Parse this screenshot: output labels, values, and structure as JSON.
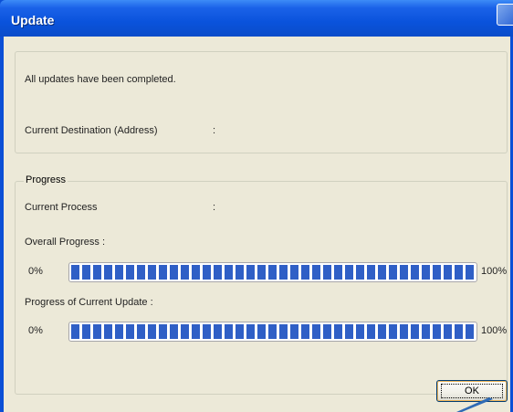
{
  "window": {
    "title": "Update"
  },
  "status": {
    "message": "All updates have been completed.",
    "destination_label": "Current Destination (Address)",
    "destination_sep": ":",
    "destination_value": ""
  },
  "progress": {
    "legend": "Progress",
    "current_process_label": "Current Process",
    "current_process_sep": ":",
    "current_process_value": "",
    "overall": {
      "label": "Overall Progress :",
      "min_label": "0%",
      "max_label": "100%",
      "value": 100
    },
    "current_update": {
      "label": "Progress of Current Update :",
      "min_label": "0%",
      "max_label": "100%",
      "value": 100
    }
  },
  "buttons": {
    "ok_label": "OK"
  },
  "colors": {
    "titlebar": "#0a53dc",
    "dialog_bg": "#ece9d8",
    "progress_block": "#2f5fc6"
  }
}
